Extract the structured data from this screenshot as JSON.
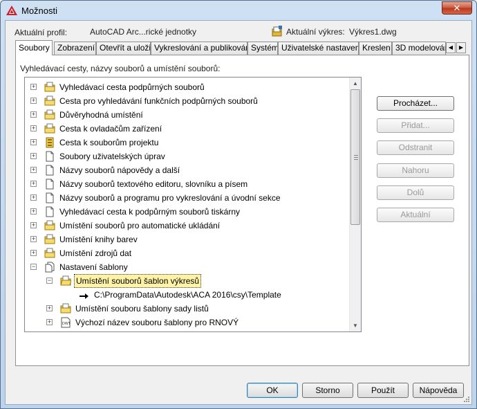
{
  "window": {
    "title": "Možnosti",
    "close_label": "✕"
  },
  "header": {
    "profile_label": "Aktuální profil:",
    "profile_value": "AutoCAD Arc...rické jednotky",
    "drawing_label": "Aktuální výkres:",
    "drawing_value": "Výkres1.dwg"
  },
  "tabs": [
    {
      "label": "Soubory",
      "active": true
    },
    {
      "label": "Zobrazení",
      "active": false
    },
    {
      "label": "Otevřít a uložit",
      "active": false
    },
    {
      "label": "Vykreslování a publikování",
      "active": false
    },
    {
      "label": "Systém",
      "active": false
    },
    {
      "label": "Uživatelské nastavení",
      "active": false
    },
    {
      "label": "Kreslení",
      "active": false
    },
    {
      "label": "3D modelování",
      "active": false
    }
  ],
  "panel": {
    "caption": "Vyhledávací cesty, názvy souborů a umístění souborů:"
  },
  "tree": {
    "items": [
      {
        "label": "Vyhledávací cesta podpůrných souborů",
        "icon": "folder-icon",
        "level": 0,
        "expander": "+"
      },
      {
        "label": "Cesta pro vyhledávání funkčních podpůrných souborů",
        "icon": "folder-icon",
        "level": 0,
        "expander": "+"
      },
      {
        "label": "Důvěryhodná umístění",
        "icon": "folder-icon",
        "level": 0,
        "expander": "+"
      },
      {
        "label": "Cesta k ovladačům zařízení",
        "icon": "folder-icon",
        "level": 0,
        "expander": "+"
      },
      {
        "label": "Cesta k souborům projektu",
        "icon": "project-icon",
        "level": 0,
        "expander": "+"
      },
      {
        "label": "Soubory uživatelských úprav",
        "icon": "document-icon",
        "level": 0,
        "expander": "+"
      },
      {
        "label": "Názvy souborů nápovědy a další",
        "icon": "document-icon",
        "level": 0,
        "expander": "+"
      },
      {
        "label": "Názvy souborů textového editoru, slovníku a písem",
        "icon": "document-icon",
        "level": 0,
        "expander": "+"
      },
      {
        "label": "Názvy souborů a programu pro vykreslování a úvodní sekce",
        "icon": "document-icon",
        "level": 0,
        "expander": "+"
      },
      {
        "label": "Vyhledávací cesta k podpůrným souborů tiskárny",
        "icon": "document-icon",
        "level": 0,
        "expander": "+"
      },
      {
        "label": "Umístění souborů pro automatické ukládání",
        "icon": "folder-icon",
        "level": 0,
        "expander": "+"
      },
      {
        "label": "Umístění knihy barev",
        "icon": "folder-icon",
        "level": 0,
        "expander": "+"
      },
      {
        "label": "Umístění zdrojů dat",
        "icon": "folder-icon",
        "level": 0,
        "expander": "+"
      },
      {
        "label": "Nastavení šablony",
        "icon": "documents-icon",
        "level": 0,
        "expander": "−"
      },
      {
        "label": "Umístění souborů šablon výkresů",
        "icon": "open-folder-icon",
        "level": 1,
        "expander": "−",
        "selected": true
      },
      {
        "label": "C:\\ProgramData\\Autodesk\\ACA 2016\\csy\\Template",
        "icon": "arrow-icon",
        "level": 2,
        "expander": ""
      },
      {
        "label": "Umístění souboru šablony sady listů",
        "icon": "folder-icon",
        "level": 1,
        "expander": "+"
      },
      {
        "label": "Výchozí název souboru šablony pro RNOVÝ",
        "icon": "dwt-icon",
        "level": 1,
        "expander": "+"
      }
    ]
  },
  "side_buttons": [
    {
      "label": "Procházet...",
      "enabled": true
    },
    {
      "label": "Přidat...",
      "enabled": false
    },
    {
      "label": "Odstranit",
      "enabled": false
    },
    {
      "label": "Nahoru",
      "enabled": false
    },
    {
      "label": "Dolů",
      "enabled": false
    },
    {
      "label": "Aktuální",
      "enabled": false
    }
  ],
  "bottom_buttons": {
    "ok": "OK",
    "cancel": "Storno",
    "apply": "Použít",
    "help": "Nápověda"
  }
}
